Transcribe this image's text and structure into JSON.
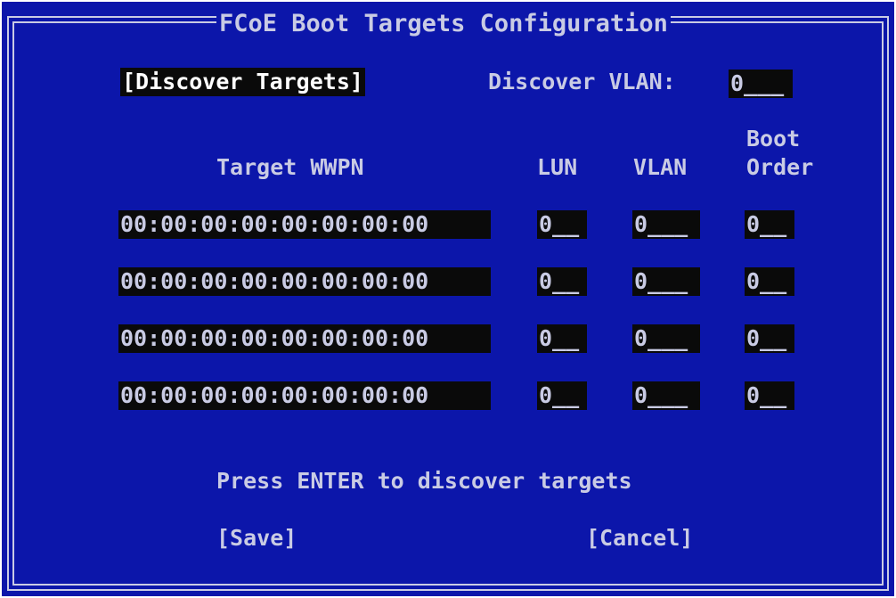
{
  "dialog": {
    "title": "FCoE Boot Targets Configuration"
  },
  "discover": {
    "button_label": "[Discover Targets]",
    "vlan_label": "Discover VLAN:",
    "vlan_value": "0___"
  },
  "columns": {
    "wwpn": "Target WWPN",
    "lun": "LUN",
    "vlan": "VLAN",
    "boot_order_line1": "Boot",
    "boot_order_line2": "Order"
  },
  "targets": [
    {
      "wwpn": "00:00:00:00:00:00:00:00",
      "lun": "0__",
      "vlan": "0___",
      "boot_order": "0__"
    },
    {
      "wwpn": "00:00:00:00:00:00:00:00",
      "lun": "0__",
      "vlan": "0___",
      "boot_order": "0__"
    },
    {
      "wwpn": "00:00:00:00:00:00:00:00",
      "lun": "0__",
      "vlan": "0___",
      "boot_order": "0__"
    },
    {
      "wwpn": "00:00:00:00:00:00:00:00",
      "lun": "0__",
      "vlan": "0___",
      "boot_order": "0__"
    }
  ],
  "status_message": "Press ENTER to discover targets",
  "actions": {
    "save_label": "[Save]",
    "cancel_label": "[Cancel]"
  },
  "colors": {
    "background": "#0c16aa",
    "text": "#c9cbe4",
    "field_background": "#0a0a0a"
  }
}
